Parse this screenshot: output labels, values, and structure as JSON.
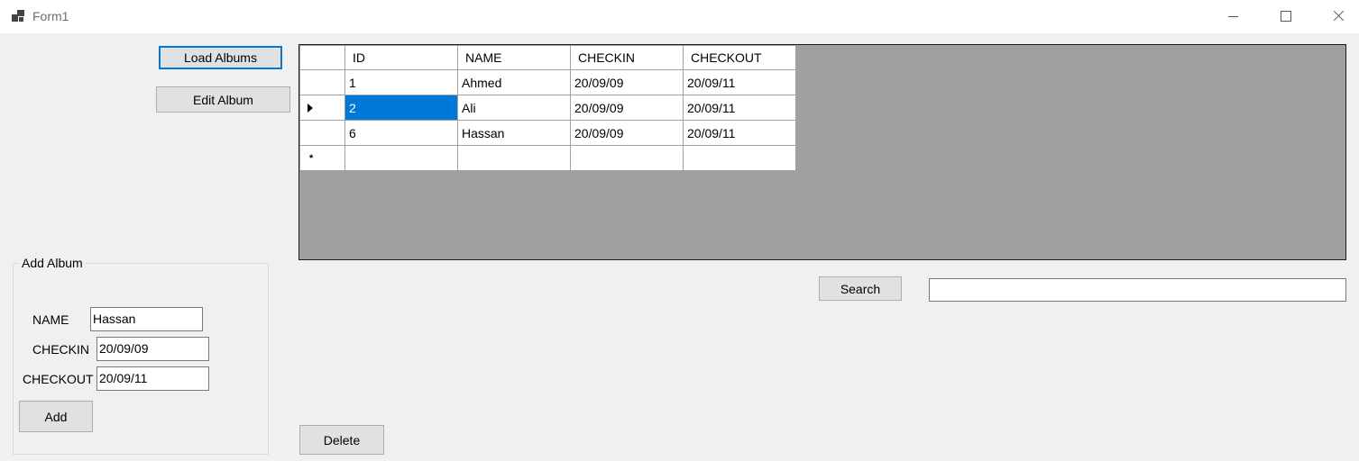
{
  "window": {
    "title": "Form1"
  },
  "toolbar": {
    "load_label": "Load Albums",
    "edit_label": "Edit Album"
  },
  "grid": {
    "columns": [
      "ID",
      "NAME",
      "CHECKIN",
      "CHECKOUT"
    ],
    "rows": [
      [
        "1",
        "Ahmed",
        "20/09/09",
        "20/09/11"
      ],
      [
        "2",
        "Ali",
        "20/09/09",
        "20/09/11"
      ],
      [
        "6",
        "Hassan",
        "20/09/09",
        "20/09/11"
      ]
    ],
    "selected_row": 1
  },
  "search": {
    "label": "Search",
    "value": ""
  },
  "delete_label": "Delete",
  "add_album": {
    "title": "Add Album",
    "name_label": "NAME",
    "checkin_label": "CHECKIN",
    "checkout_label": "CHECKOUT",
    "name_value": "Hassan",
    "checkin_value": "20/09/09",
    "checkout_value": "20/09/11",
    "add_label": "Add"
  },
  "colors": {
    "selection": "#0078d7",
    "grid_background": "#a0a0a0",
    "form_background": "#f0f0f0"
  }
}
